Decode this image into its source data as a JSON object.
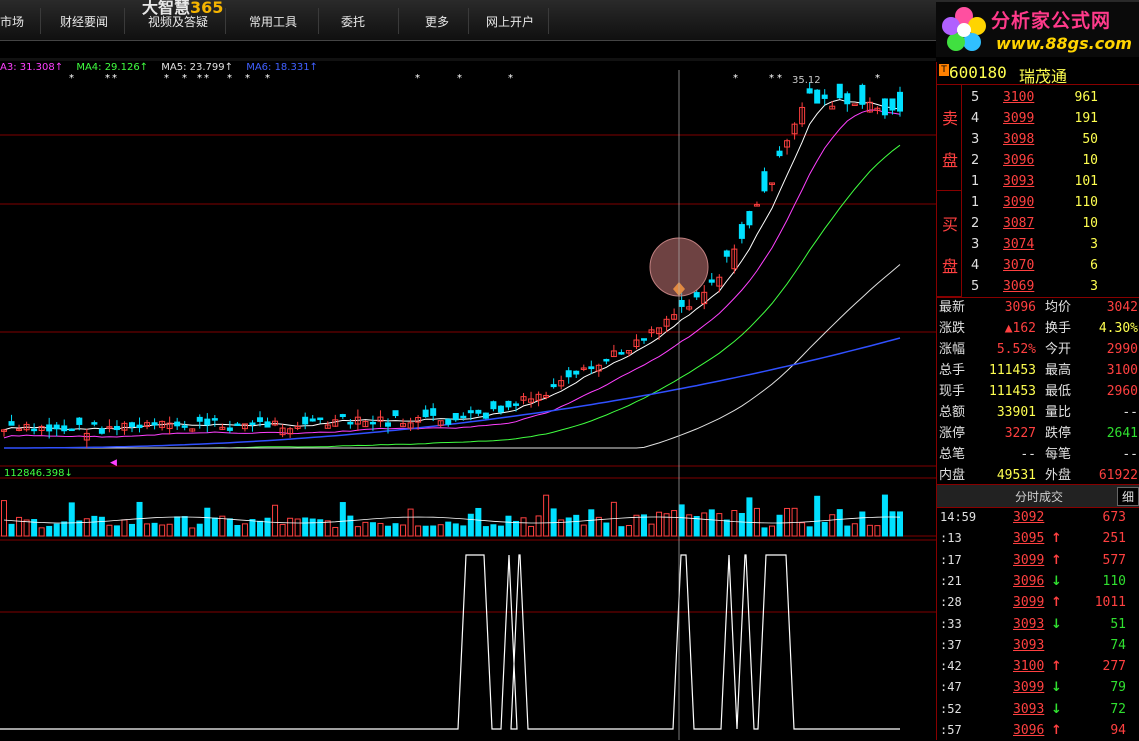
{
  "menu": {
    "app_title_main": "大智慧",
    "app_title_suffix": "365",
    "items": [
      "市场",
      "财经要闻",
      "视频及答疑",
      "常用工具",
      "委托",
      "更多",
      "网上开户"
    ]
  },
  "brand": {
    "name": "分析家公式网",
    "url": "www.88gs.com"
  },
  "indicators": [
    {
      "label": "A3: 31.308↑",
      "color": "#ff40ff"
    },
    {
      "label": "MA4: 29.126↑",
      "color": "#40ff40"
    },
    {
      "label": "MA5: 23.799↑",
      "color": "#e0e0e0"
    },
    {
      "label": "MA6: 18.331↑",
      "color": "#4060ff"
    }
  ],
  "price_annotation": "35.12",
  "volume_label": "112846.398↓",
  "stock": {
    "flag": "T",
    "code": "600180",
    "name": "瑞茂通"
  },
  "order_book": {
    "sell_label_1": "卖",
    "sell_label_2": "盘",
    "buy_label_1": "买",
    "buy_label_2": "盘",
    "sell": [
      {
        "level": "5",
        "price": "3100",
        "vol": "961"
      },
      {
        "level": "4",
        "price": "3099",
        "vol": "191"
      },
      {
        "level": "3",
        "price": "3098",
        "vol": "50"
      },
      {
        "level": "2",
        "price": "3096",
        "vol": "10"
      },
      {
        "level": "1",
        "price": "3093",
        "vol": "101"
      }
    ],
    "buy": [
      {
        "level": "1",
        "price": "3090",
        "vol": "110"
      },
      {
        "level": "2",
        "price": "3087",
        "vol": "10"
      },
      {
        "level": "3",
        "price": "3074",
        "vol": "3"
      },
      {
        "level": "4",
        "price": "3070",
        "vol": "6"
      },
      {
        "level": "5",
        "price": "3069",
        "vol": "3"
      }
    ]
  },
  "quote": [
    {
      "l1": "最新",
      "v1": "3096",
      "c1": "red",
      "l2": "均价",
      "v2": "3042",
      "c2": "red"
    },
    {
      "l1": "涨跌",
      "v1": "▲162",
      "c1": "red",
      "l2": "换手",
      "v2": "4.30%",
      "c2": "yel"
    },
    {
      "l1": "涨幅",
      "v1": "5.52%",
      "c1": "red",
      "l2": "今开",
      "v2": "2990",
      "c2": "red"
    },
    {
      "l1": "总手",
      "v1": "111453",
      "c1": "yel",
      "l2": "最高",
      "v2": "3100",
      "c2": "red"
    },
    {
      "l1": "现手",
      "v1": "111453",
      "c1": "yel",
      "l2": "最低",
      "v2": "2960",
      "c2": "red"
    },
    {
      "l1": "总额",
      "v1": "33901",
      "c1": "yel",
      "l2": "量比",
      "v2": "--",
      "c2": "wht"
    },
    {
      "l1": "涨停",
      "v1": "3227",
      "c1": "red",
      "l2": "跌停",
      "v2": "2641",
      "c2": "grn"
    },
    {
      "l1": "总笔",
      "v1": "--",
      "c1": "wht",
      "l2": "每笔",
      "v2": "--",
      "c2": "wht"
    },
    {
      "l1": "内盘",
      "v1": "49531",
      "c1": "yel",
      "l2": "外盘",
      "v2": "61922",
      "c2": "red"
    }
  ],
  "ticks_header": {
    "title": "分时成交",
    "detail": "细"
  },
  "ticks": [
    {
      "time": "14:59",
      "price": "3092",
      "arrow": "",
      "vol": "673",
      "dir": "none"
    },
    {
      "time": ":13",
      "price": "3095",
      "arrow": "↑",
      "vol": "251",
      "dir": "up"
    },
    {
      "time": ":17",
      "price": "3099",
      "arrow": "↑",
      "vol": "577",
      "dir": "up"
    },
    {
      "time": ":21",
      "price": "3096",
      "arrow": "↓",
      "vol": "110",
      "dir": "down"
    },
    {
      "time": ":28",
      "price": "3099",
      "arrow": "↑",
      "vol": "1011",
      "dir": "up"
    },
    {
      "time": ":33",
      "price": "3093",
      "arrow": "↓",
      "vol": "51",
      "dir": "down"
    },
    {
      "time": ":37",
      "price": "3093",
      "arrow": "",
      "vol": "74",
      "dir": "down"
    },
    {
      "time": ":42",
      "price": "3100",
      "arrow": "↑",
      "vol": "277",
      "dir": "up"
    },
    {
      "time": ":47",
      "price": "3099",
      "arrow": "↓",
      "vol": "79",
      "dir": "down"
    },
    {
      "time": ":52",
      "price": "3093",
      "arrow": "↓",
      "vol": "72",
      "dir": "down"
    },
    {
      "time": ":57",
      "price": "3096",
      "arrow": "↑",
      "vol": "94",
      "dir": "up"
    }
  ],
  "colors": {
    "up": "#ff4040",
    "down": "#00e0ff",
    "grid": "#800000",
    "ma1": "#ffffff",
    "ma2": "#ff40ff",
    "ma3": "#40ff40",
    "ma4": "#e0e0e0",
    "ma5": "#3050ff"
  }
}
